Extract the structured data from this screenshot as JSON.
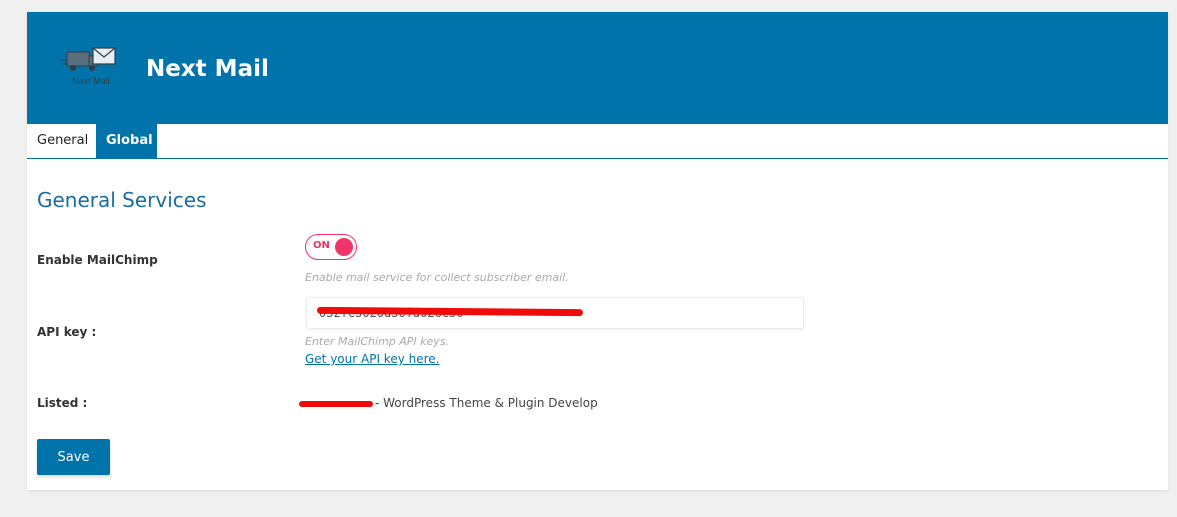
{
  "header": {
    "logo_text": "Next Mail",
    "title": "Next Mail",
    "logo_icon": "truck-envelope-icon"
  },
  "tabs": [
    {
      "label": "General",
      "active": true
    },
    {
      "label": "Global",
      "active": false
    }
  ],
  "section": {
    "title": "General Services"
  },
  "mailchimp": {
    "label": "Enable MailChimp",
    "toggle_text": "ON",
    "toggle_state": true,
    "hint": "Enable mail service for collect subscriber email."
  },
  "api": {
    "label": "API key :",
    "value": "032fc3020d50fd026c50",
    "hint": "Enter MailChimp API keys.",
    "link_text": "Get your API key here."
  },
  "listed": {
    "label": "Listed :",
    "value": "- WordPress Theme & Plugin Develop"
  },
  "save_label": "Save",
  "colors": {
    "primary": "#0073aa",
    "toggle": "#f0356b",
    "redaction": "#f00a0a"
  }
}
